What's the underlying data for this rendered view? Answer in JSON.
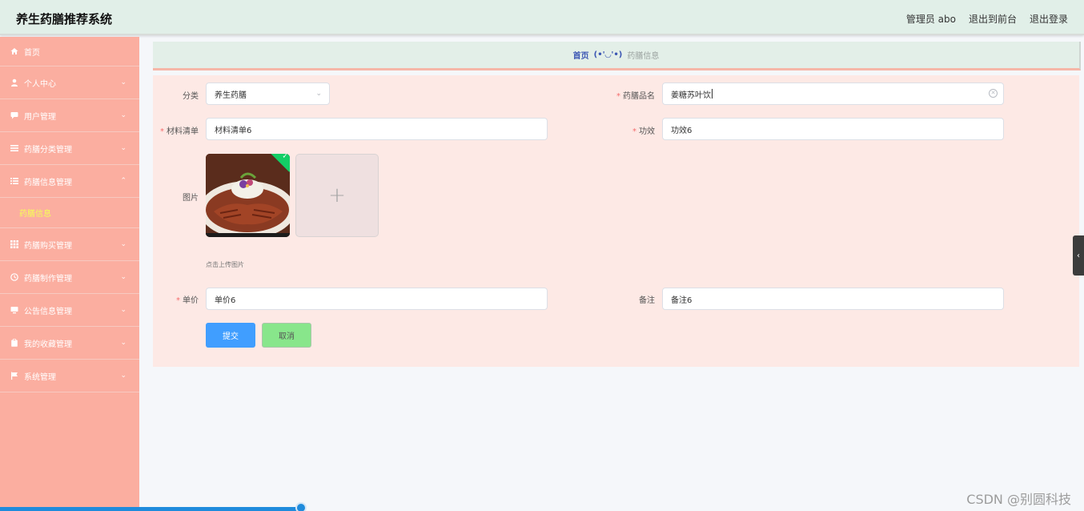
{
  "app": {
    "title": "养生药膳推荐系统"
  },
  "header": {
    "user_role": "管理员",
    "username": "abo",
    "to_front_label": "退出到前台",
    "logout_label": "退出登录"
  },
  "sidebar": {
    "items": [
      {
        "label": "首页",
        "icon": "home-icon",
        "has_chevron": false
      },
      {
        "label": "个人中心",
        "icon": "user-icon",
        "has_chevron": true
      },
      {
        "label": "用户管理",
        "icon": "chat-icon",
        "has_chevron": true
      },
      {
        "label": "药膳分类管理",
        "icon": "list-icon",
        "has_chevron": true
      },
      {
        "label": "药膳信息管理",
        "icon": "list-icon",
        "has_chevron": true,
        "expanded": true
      },
      {
        "label": "药膳购买管理",
        "icon": "grid-icon",
        "has_chevron": true
      },
      {
        "label": "药膳制作管理",
        "icon": "clock-icon",
        "has_chevron": true
      },
      {
        "label": "公告信息管理",
        "icon": "monitor-icon",
        "has_chevron": true
      },
      {
        "label": "我的收藏管理",
        "icon": "clipboard-icon",
        "has_chevron": true
      },
      {
        "label": "系统管理",
        "icon": "flag-icon",
        "has_chevron": true
      }
    ],
    "sub_item": "药膳信息"
  },
  "breadcrumb": {
    "home": "首页",
    "face": "(•'◡'•)",
    "current": "药膳信息"
  },
  "form": {
    "category_label": "分类",
    "category_value": "养生药膳",
    "name_label": "药膳品名",
    "name_value": "姜糖苏叶饮",
    "ingredients_label": "材料清单",
    "ingredients_value": "材料清单6",
    "effect_label": "功效",
    "effect_value": "功效6",
    "image_label": "图片",
    "upload_tip": "点击上传图片",
    "price_label": "单价",
    "price_value": "单价6",
    "remark_label": "备注",
    "remark_value": "备注6",
    "submit_label": "提交",
    "cancel_label": "取消"
  },
  "watermark": "CSDN @别圆科技",
  "colors": {
    "header_bg": "#e1efe8",
    "sidebar_bg": "#fbaea0",
    "panel_bg": "#fde9e5",
    "submit": "#409eff",
    "cancel": "#88e68b"
  }
}
